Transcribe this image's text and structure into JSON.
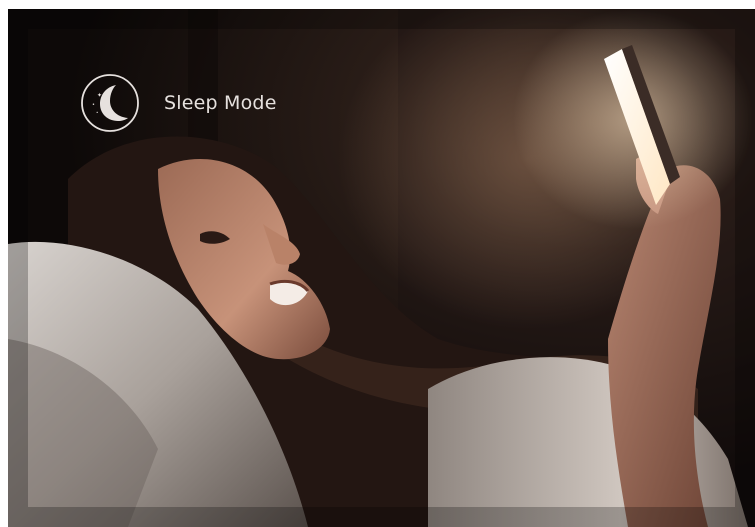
{
  "badge": {
    "label": "Sleep Mode",
    "icon": "moon-stars-icon"
  },
  "colors": {
    "background": "#120c0b",
    "screen_glow": "#fff3dc",
    "badge_text": "#e6e1de"
  }
}
